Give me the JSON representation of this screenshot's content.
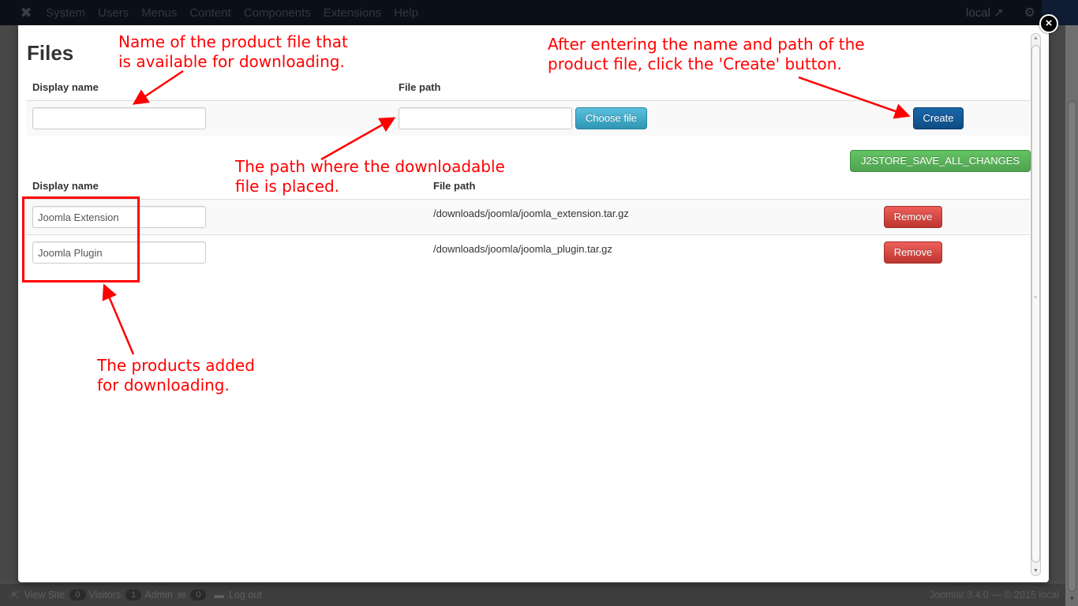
{
  "admin": {
    "logo_icon": "joomla-logo-icon",
    "menu": [
      "System",
      "Users",
      "Menus",
      "Content",
      "Components",
      "Extensions",
      "Help"
    ],
    "site_link": "local",
    "site_link_icon": "external-link-icon",
    "settings_icon": "gear-icon"
  },
  "statusbar": {
    "view_site": "View Site",
    "visitors_count": "0",
    "visitors_label": "Visitors",
    "admin_count": "1",
    "admin_label": "Admin",
    "messages_count": "0",
    "logout": "Log out",
    "footer": "Joomla! 3.4.0  —  © 2015 local"
  },
  "modal": {
    "close_icon": "×",
    "title": "Files",
    "create_form": {
      "display_name_header": "Display name",
      "file_path_header": "File path",
      "display_name_value": "",
      "file_path_value": "",
      "choose_file_label": "Choose file",
      "create_label": "Create"
    },
    "save_all_label": "J2STORE_SAVE_ALL_CHANGES",
    "files_table": {
      "headers": {
        "display_name": "Display name",
        "file_path": "File path"
      },
      "rows": [
        {
          "display_name": "Joomla Extension",
          "file_path": "/downloads/joomla/joomla_extension.tar.gz",
          "remove_label": "Remove"
        },
        {
          "display_name": "Joomla Plugin",
          "file_path": "/downloads/joomla/joomla_plugin.tar.gz",
          "remove_label": "Remove"
        }
      ]
    }
  },
  "annotations": {
    "color": "#ff0000",
    "display_name_note": [
      "Name of the product file that",
      "is available for downloading."
    ],
    "file_path_note": [
      "The path where the downloadable",
      "file is placed."
    ],
    "create_note": [
      "After entering the name and path of the",
      "product file, click the 'Create' button."
    ],
    "products_note": [
      "The products added",
      "for downloading."
    ]
  }
}
